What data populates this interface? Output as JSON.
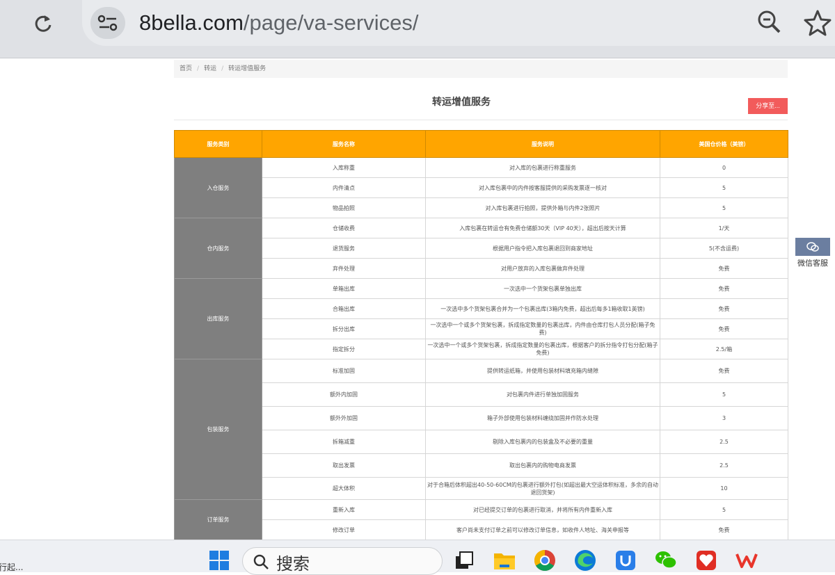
{
  "browser": {
    "url_host": "8bella.com",
    "url_path": "/page/va-services/"
  },
  "breadcrumb": [
    "首页",
    "转运",
    "转运增值服务"
  ],
  "page_title": "转运增值服务",
  "share_label": "分享至...",
  "table": {
    "headers": [
      "服务类别",
      "服务名称",
      "服务说明",
      "美国仓价格（美镑）"
    ],
    "groups": [
      {
        "category": "入仓服务",
        "rows": [
          {
            "name": "入库称重",
            "desc": "对入库的包裹进行称重服务",
            "price": "0"
          },
          {
            "name": "内件清点",
            "desc": "对入库包裹中的内件按客服提供的采购发票逐一核对",
            "price": "5"
          },
          {
            "name": "物品拍照",
            "desc": "对入库包裹进行拍照，提供外箱与内件2张照片",
            "price": "5"
          }
        ]
      },
      {
        "category": "仓内服务",
        "rows": [
          {
            "name": "仓储收费",
            "desc": "入库包裹在转运仓有免费仓储额30天（VIP 40天），超出后按天计算",
            "price": "1/天"
          },
          {
            "name": "退货服务",
            "desc": "根据用户指令把入库包裹退回到商家地址",
            "price": "5(不含运费)"
          },
          {
            "name": "弃件处理",
            "desc": "对用户放弃的入库包裹做弃件处理",
            "price": "免费"
          }
        ]
      },
      {
        "category": "出库服务",
        "rows": [
          {
            "name": "单箱出库",
            "desc": "一次选中一个货架包裹单独出库",
            "price": "免费"
          },
          {
            "name": "合箱出库",
            "desc": "一次选中多个货架包裹合并为一个包裹出库(3箱内免费，超出后每多1箱收取1英镑)",
            "price": "免费"
          },
          {
            "name": "拆分出库",
            "desc": "一次选中一个或多个货架包裹，拆成指定数量的包裹出库，内件由仓库打包人员分配(箱子免费)",
            "price": "免费"
          },
          {
            "name": "指定拆分",
            "desc": "一次选中一个或多个货架包裹，拆成指定数量的包裹出库，根据客户的拆分指令打包分配(箱子免费)",
            "price": "2.5/箱"
          }
        ]
      },
      {
        "category": "包装服务",
        "rows": [
          {
            "name": "标准加固",
            "desc": "提供转运纸箱，并使用包装材料填充箱内缝隙",
            "price": "免费"
          },
          {
            "name": "额外内加固",
            "desc": "对包裹内件进行单独加固服务",
            "price": "5"
          },
          {
            "name": "额外外加固",
            "desc": "箱子外部使用包装材料缠绕加固并作防水处理",
            "price": "3"
          },
          {
            "name": "拆箱减重",
            "desc": "剔除入库包裹内的包装盒及不必要的重量",
            "price": "2.5"
          },
          {
            "name": "取出发票",
            "desc": "取出包裹内的购物电商发票",
            "price": "2.5"
          },
          {
            "name": "超大体积",
            "desc": "对于合箱后体积超出40-50-60CM的包裹进行额外打包(如超出最大空运体积标准，多余的自动退回货架)",
            "price": "10"
          }
        ]
      },
      {
        "category": "订单服务",
        "rows": [
          {
            "name": "重新入库",
            "desc": "对已经提交订单的包裹进行取消，并将所有内件重新入库",
            "price": "5"
          },
          {
            "name": "修改订单",
            "desc": "客户尚未支付订单之前可以修改订单信息，如收件人地址、海关申报等",
            "price": "免费"
          }
        ]
      }
    ]
  },
  "side_widget": {
    "label": "微信客服"
  },
  "taskbar": {
    "status_text": "行起...",
    "search_label": "搜索",
    "icons": [
      "windows-start-icon",
      "task-view-icon",
      "file-explorer-icon",
      "chrome-icon",
      "edge-icon",
      "shield-app-icon",
      "wechat-icon",
      "heart-app-icon",
      "wps-icon"
    ]
  },
  "colors": {
    "header_orange": "#ffa500",
    "category_gray": "#7f7f7f",
    "share_red": "#f25b5b",
    "wechat_blue": "#6b7ea0"
  }
}
